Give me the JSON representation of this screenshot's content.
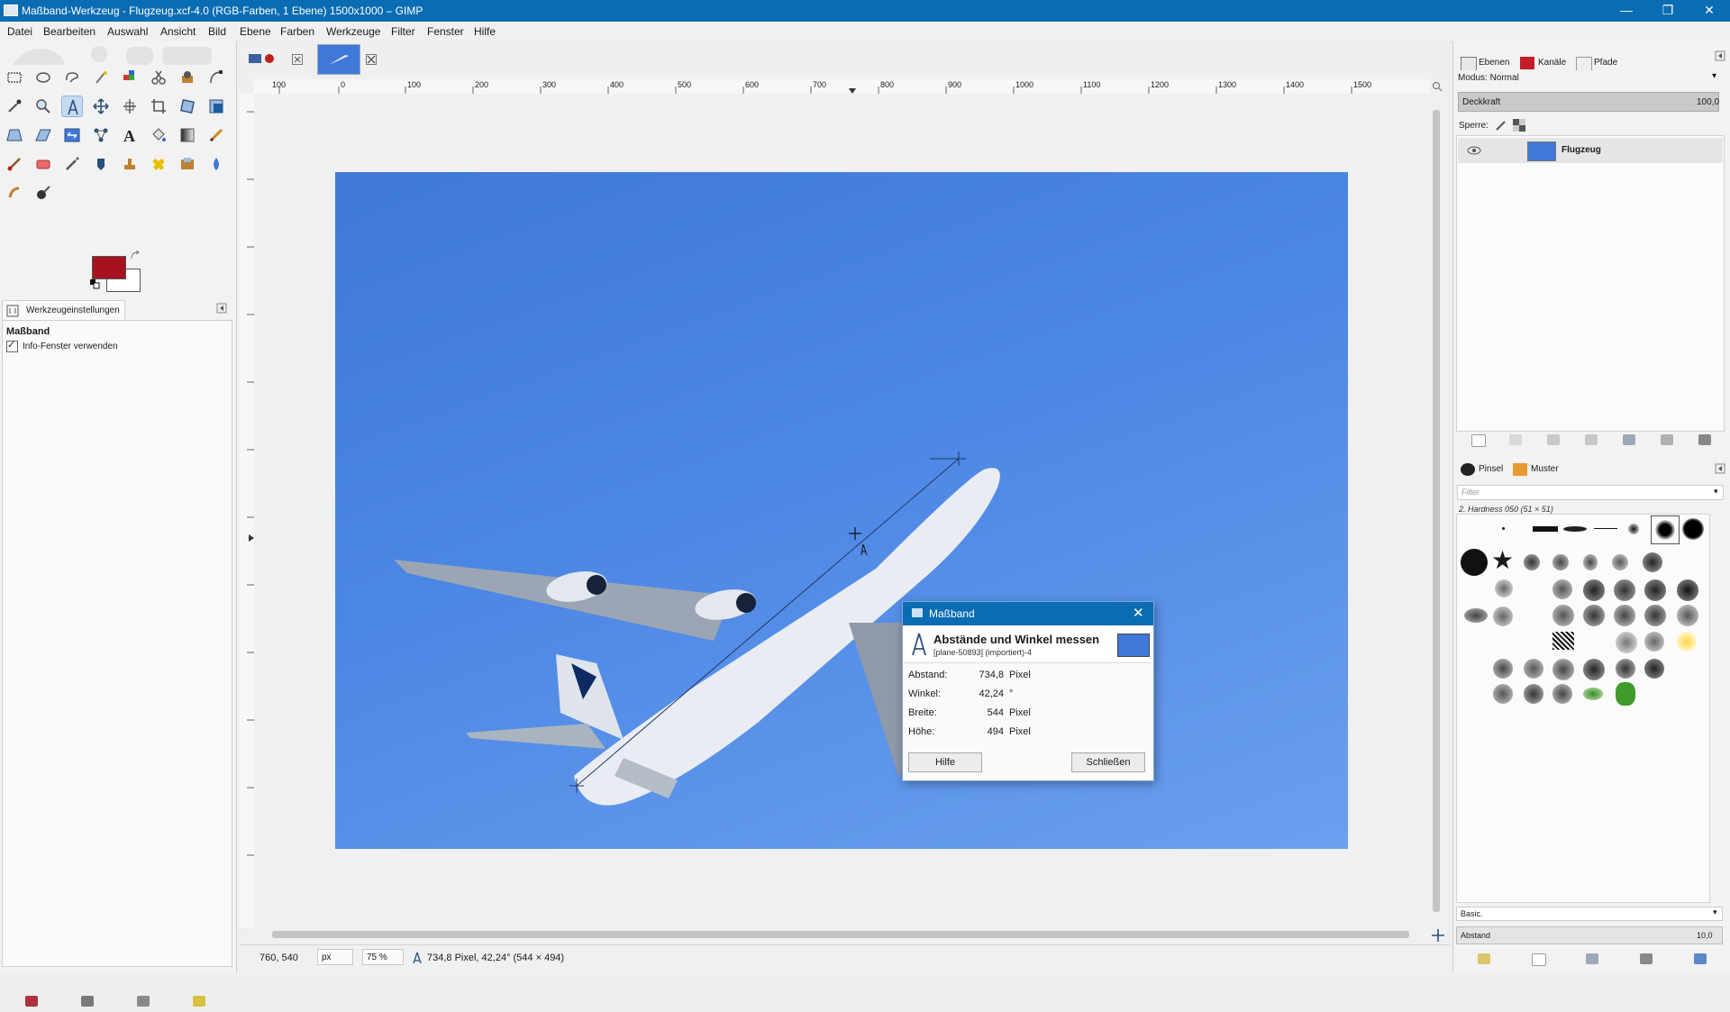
{
  "window": {
    "title": "Maßband-Werkzeug - Flugzeug.xcf-4.0 (RGB-Farben, 1 Ebene) 1500x1000 – GIMP",
    "minimize": "—",
    "maximize": "❐",
    "close": "✕"
  },
  "menu": [
    "Datei",
    "Bearbeiten",
    "Auswahl",
    "Ansicht",
    "Bild",
    "Ebene",
    "Farben",
    "Werkzeuge",
    "Filter",
    "Fenster",
    "Hilfe"
  ],
  "toolbox": {
    "tool_options_tab": "Werkzeugeinstellungen",
    "options_title": "Maßband",
    "checkbox_label": "Info-Fenster verwenden",
    "checkbox_checked": true,
    "fg_color": "#a8121f",
    "bg_color": "#ffffff"
  },
  "ruler": {
    "h_ticks": [
      "100",
      "0",
      "100",
      "200",
      "300",
      "400",
      "500",
      "600",
      "700",
      "800",
      "900",
      "1000",
      "1100",
      "1200",
      "1300",
      "1400",
      "1500"
    ]
  },
  "statusbar": {
    "coords": "760, 540",
    "unit": "px",
    "zoom": "75 %",
    "info": "734,8 Pixel, 42,24° (544 × 494)"
  },
  "dialog": {
    "title": "Maßband",
    "heading": "Abstände und Winkel messen",
    "subheading": "[plane-50893] (importiert)-4",
    "rows": [
      {
        "label": "Abstand:",
        "value": "734,8",
        "unit": "Pixel"
      },
      {
        "label": "Winkel:",
        "value": "42,24",
        "unit": "°"
      },
      {
        "label": "Breite:",
        "value": "544",
        "unit": "Pixel"
      },
      {
        "label": "Höhe:",
        "value": "494",
        "unit": "Pixel"
      }
    ],
    "help_button": "Hilfe",
    "close_button": "Schließen"
  },
  "dock": {
    "tabs": [
      "Ebenen",
      "Kanäle",
      "Pfade"
    ],
    "mode_label": "Modus: Normal",
    "opacity_label": "Deckkraft",
    "opacity_value": "100,0",
    "lock_label": "Sperre:",
    "layer_name": "Flugzeug",
    "brush_tabs": [
      "Pinsel",
      "Muster"
    ],
    "filter_placeholder": "Filter",
    "brush_name": "2. Hardness 050 (51 × 51)",
    "preset": "Basic.",
    "spacing_label": "Abstand",
    "spacing_value": "10,0"
  },
  "colors": {
    "titlebar": "#0a6cb3",
    "sky": "#4d87e4",
    "fg": "#a8121f"
  }
}
